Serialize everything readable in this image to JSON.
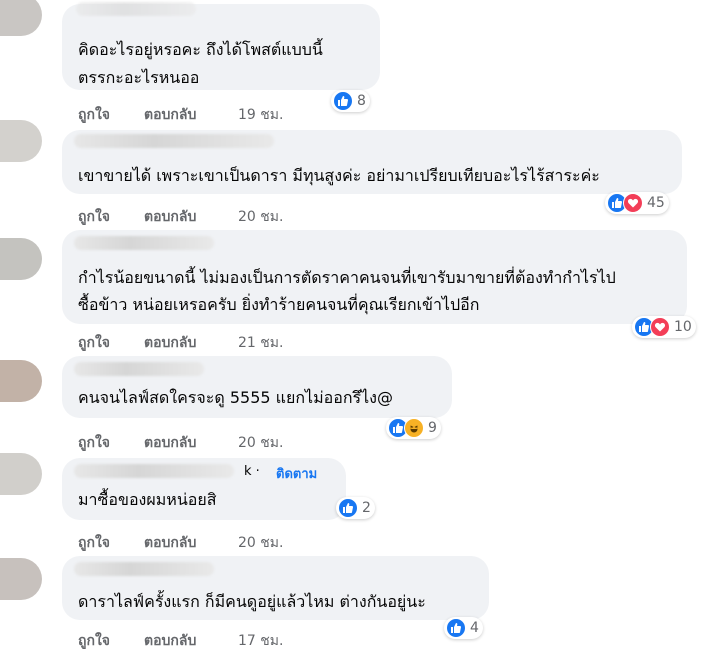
{
  "comments": [
    {
      "text_lines": [
        "คิดอะไรอยู่หรอคะ ถึงได้โพสต์แบบนี้",
        "ตรรกะอะไรหนออ"
      ],
      "like": "ถูกใจ",
      "reply": "ตอบกลับ",
      "time": "19 ชม.",
      "reactions": [
        "like-icon"
      ],
      "count": "8"
    },
    {
      "text_lines": [
        "เขาขายได้ เพราะเขาเป็นดารา มีทุนสูงค่ะ อย่ามาเปรียบเทียบอะไรไร้สาระค่ะ"
      ],
      "like": "ถูกใจ",
      "reply": "ตอบกลับ",
      "time": "20 ชม.",
      "reactions": [
        "like-icon",
        "love-icon"
      ],
      "count": "45"
    },
    {
      "text_lines": [
        "กำไรน้อยขนาดนี้ ไม่มองเป็นการตัดราคาคนจนที่เขารับมาขายที่ต้องทำกำไรไป",
        "ซื้อข้าว หน่อยเหรอครับ ยิ่งทำร้ายคนจนที่คุณเรียกเข้าไปอีก"
      ],
      "like": "ถูกใจ",
      "reply": "ตอบกลับ",
      "time": "21 ชม.",
      "reactions": [
        "like-icon",
        "love-icon"
      ],
      "count": "10"
    },
    {
      "text_lines": [
        "คนจนไลฟ์สดใครจะดู 5555 แยกไม่ออกรึไง@"
      ],
      "like": "ถูกใจ",
      "reply": "ตอบกลับ",
      "time": "20 ชม.",
      "reactions": [
        "like-icon",
        "haha-icon"
      ],
      "count": "9"
    },
    {
      "text_lines": [
        "มาซื้อของผมหน่อยสิ"
      ],
      "name_suffix": "k ·",
      "follow": "ติดตาม",
      "like": "ถูกใจ",
      "reply": "ตอบกลับ",
      "time": "20 ชม.",
      "reactions": [
        "like-icon"
      ],
      "count": "2"
    },
    {
      "text_lines": [
        "ดาราไลฟ์ครั้งแรก ก็มีคนดูอยู่แล้วไหม ต่างกันอยู่นะ"
      ],
      "like": "ถูกใจ",
      "reply": "ตอบกลับ",
      "time": "17 ชม.",
      "reactions": [
        "like-icon"
      ],
      "count": "4"
    }
  ]
}
